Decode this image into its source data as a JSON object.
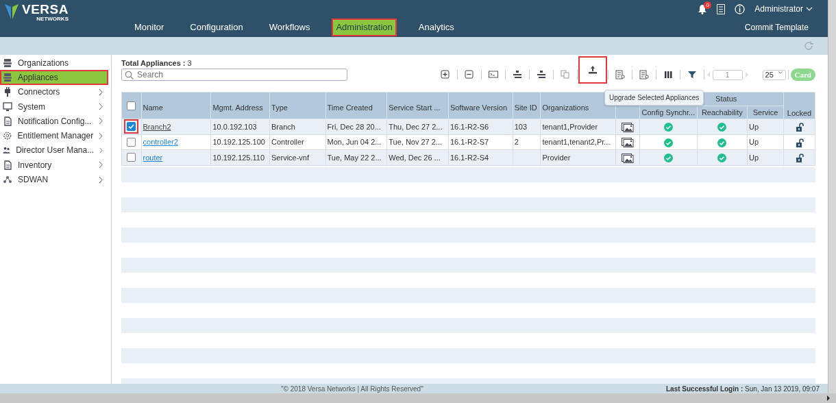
{
  "header": {
    "logo_text": "VERSA",
    "logo_subtext": "NETWORKS",
    "notification_count": "0",
    "user": "Administrator",
    "commit_button": "Commit Template"
  },
  "nav": [
    {
      "label": "Monitor",
      "selected": false,
      "highlighted": false
    },
    {
      "label": "Configuration",
      "selected": false,
      "highlighted": false
    },
    {
      "label": "Workflows",
      "selected": false,
      "highlighted": false
    },
    {
      "label": "Administration",
      "selected": true,
      "highlighted": true
    },
    {
      "label": "Analytics",
      "selected": false,
      "highlighted": false
    }
  ],
  "sidebar": {
    "items": [
      {
        "label": "Organizations",
        "selected": false,
        "highlighted": false,
        "expandable": false
      },
      {
        "label": "Appliances",
        "selected": true,
        "highlighted": true,
        "expandable": false
      },
      {
        "label": "Connectors",
        "selected": false,
        "highlighted": false,
        "expandable": true
      },
      {
        "label": "System",
        "selected": false,
        "highlighted": false,
        "expandable": true
      },
      {
        "label": "Notification Config...",
        "selected": false,
        "highlighted": false,
        "expandable": true
      },
      {
        "label": "Entitlement Manager",
        "selected": false,
        "highlighted": false,
        "expandable": true
      },
      {
        "label": "Director User Mana...",
        "selected": false,
        "highlighted": false,
        "expandable": true
      },
      {
        "label": "Inventory",
        "selected": false,
        "highlighted": false,
        "expandable": true
      },
      {
        "label": "SDWAN",
        "selected": false,
        "highlighted": false,
        "expandable": true
      }
    ]
  },
  "content": {
    "total_label": "Total Appliances :",
    "total_count": "3",
    "search": {
      "placeholder": "Search"
    },
    "toolbar": [
      {
        "kind": "plus",
        "highlighted": false
      },
      {
        "kind": "minus",
        "highlighted": false
      },
      {
        "kind": "terminal",
        "highlighted": false
      },
      {
        "kind": "device",
        "highlighted": false
      },
      {
        "kind": "device",
        "highlighted": false
      },
      {
        "kind": "copy",
        "highlighted": false
      },
      {
        "kind": "upload",
        "highlighted": true
      },
      {
        "kind": "list",
        "highlighted": false
      },
      {
        "kind": "list",
        "highlighted": false
      },
      {
        "kind": "columns",
        "highlighted": false
      },
      {
        "kind": "filter",
        "highlighted": false
      }
    ],
    "pager": {
      "page": "1",
      "page_size": "25",
      "view_toggle": "Card"
    },
    "tooltip": "Upgrade Selected Appliances",
    "table": {
      "all_selected": false,
      "columns": [
        "Name",
        "Mgmt. Address",
        "Type",
        "Time Created",
        "Service Start ...",
        "Software Version",
        "Site ID",
        "Organizations"
      ],
      "status_group": "Status",
      "status_columns": [
        "Config Synchr...",
        "Reachability",
        "Service"
      ],
      "locked_column": "Locked",
      "rows": [
        {
          "selected": true,
          "highlighted": true,
          "cells": [
            "Branch2",
            "10.0.192.103",
            "Branch",
            "Fri, Dec 28 20...",
            "Thu, Dec 27 2...",
            "16.1-R2-S6",
            "103",
            "tenant1,Provider"
          ],
          "config_in_sync": true,
          "reachable": true,
          "service": "Up",
          "locked": false
        },
        {
          "selected": false,
          "highlighted": false,
          "cells": [
            "controller2",
            "10.192.125.100",
            "Controller",
            "Mon, Jun 04 2...",
            "Tue, Nov 27 2...",
            "16.1-R2-S7",
            "2",
            "tenant1,tenant2,Pr..."
          ],
          "config_in_sync": true,
          "reachable": true,
          "service": "Up",
          "locked": false
        },
        {
          "selected": false,
          "highlighted": false,
          "cells": [
            "router",
            "10.192.125.110",
            "Service-vnf",
            "Tue, May 22 2...",
            "Wed, Dec 26 ...",
            "16.1-R2-S4",
            "",
            "Provider"
          ],
          "config_in_sync": true,
          "reachable": true,
          "service": "Up",
          "locked": false
        }
      ]
    }
  },
  "footer": {
    "copyright": "\"© 2018 Versa Networks | All Rights Reserved\"",
    "last_login_label": "Last Successful Login :",
    "last_login_value": "Sun, Jan 13 2019, 09:07"
  }
}
